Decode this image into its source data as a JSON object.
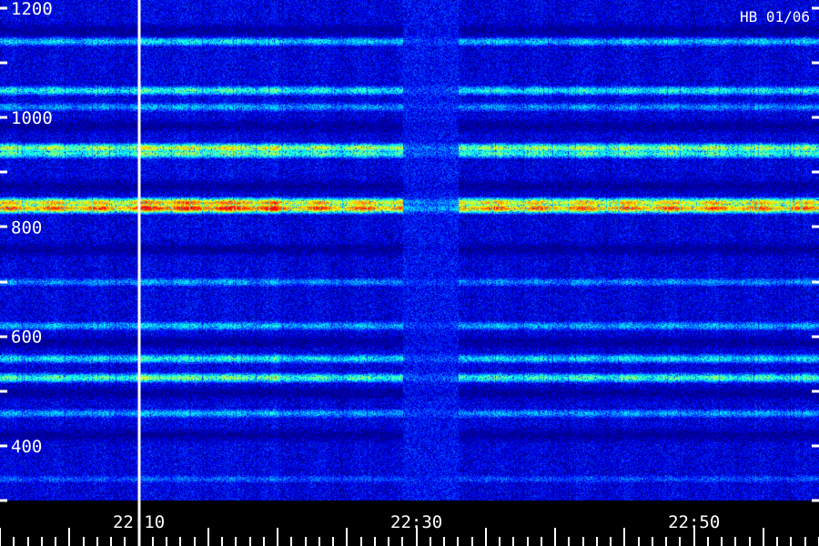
{
  "chart_data": {
    "type": "heatmap",
    "title": "",
    "station_label": "HB 01/06",
    "xlabel": "",
    "ylabel": "",
    "x_range": [
      "22:00",
      "22:59"
    ],
    "ylim": [
      300,
      1215
    ],
    "y_tick_labels": [
      {
        "value": 1200,
        "label": "1200"
      },
      {
        "value": 1000,
        "label": "1000"
      },
      {
        "value": 800,
        "label": "800"
      },
      {
        "value": 600,
        "label": "600"
      },
      {
        "value": 400,
        "label": "400"
      }
    ],
    "y_minor_ticks": [
      1100,
      900,
      700,
      500,
      300
    ],
    "x_tick_labels": [
      {
        "time": "22:10",
        "label": "22:10"
      },
      {
        "time": "22:30",
        "label": "22:30"
      },
      {
        "time": "22:50",
        "label": "22:50"
      }
    ],
    "marker_line_time": "22:10",
    "intensity_bands": [
      {
        "freq": 1140,
        "intensity": 0.42
      },
      {
        "freq": 1050,
        "intensity": 0.48
      },
      {
        "freq": 1020,
        "intensity": 0.34
      },
      {
        "freq": 945,
        "intensity": 0.66
      },
      {
        "freq": 935,
        "intensity": 0.55
      },
      {
        "freq": 845,
        "intensity": 0.82
      },
      {
        "freq": 835,
        "intensity": 0.93
      },
      {
        "freq": 700,
        "intensity": 0.33
      },
      {
        "freq": 620,
        "intensity": 0.38
      },
      {
        "freq": 560,
        "intensity": 0.45
      },
      {
        "freq": 525,
        "intensity": 0.55
      },
      {
        "freq": 460,
        "intensity": 0.36
      },
      {
        "freq": 340,
        "intensity": 0.25
      }
    ],
    "quiet_gaps_freq": [
      1160,
      985,
      875,
      760,
      590,
      497,
      420
    ],
    "interference_interval": [
      "22:29",
      "22:33"
    ],
    "colormap": [
      "#00007f",
      "#0000ff",
      "#0080ff",
      "#00ffff",
      "#80ff80",
      "#ffff00",
      "#ff8000",
      "#ff0000"
    ]
  }
}
